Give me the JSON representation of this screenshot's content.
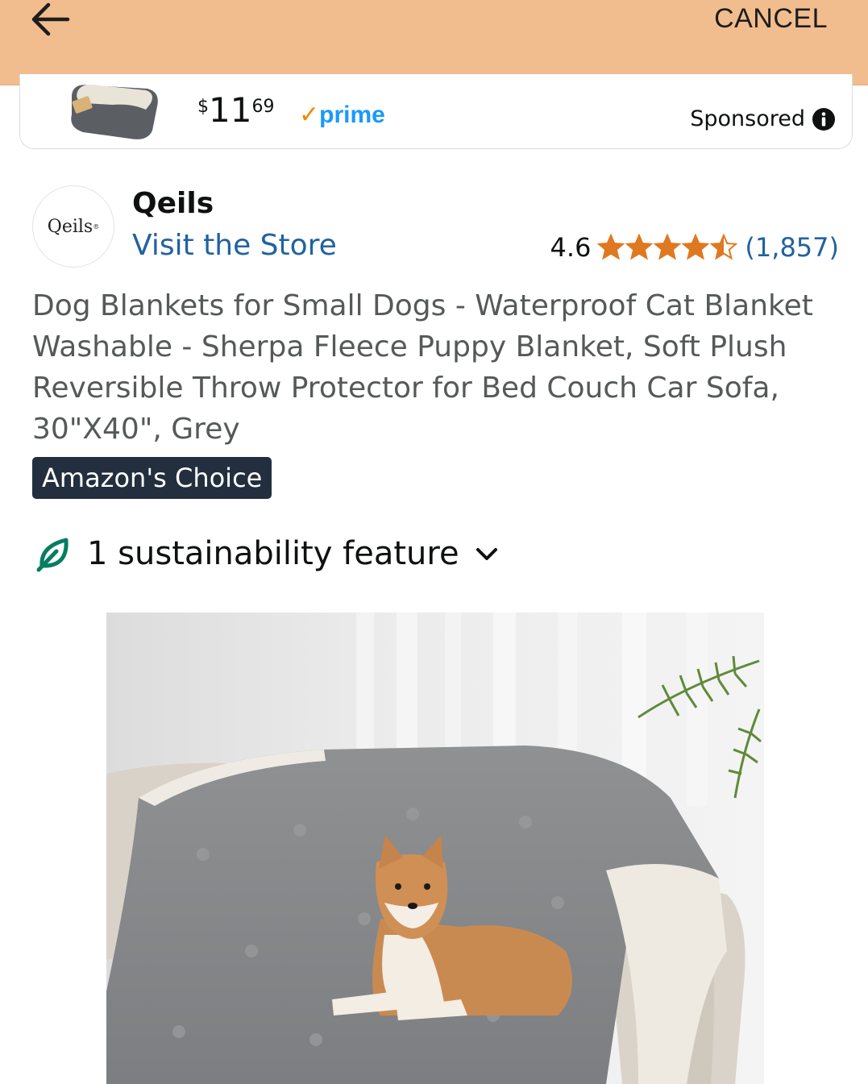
{
  "header": {
    "back_icon": "back-arrow-icon",
    "cancel_label": "CANCEL",
    "background_color": "#f2bd8e"
  },
  "sponsored_ad": {
    "price_symbol": "$",
    "price_whole": "11",
    "price_fraction": "69",
    "prime_label": "prime",
    "sponsored_label": "Sponsored",
    "info_icon": "info-icon"
  },
  "store": {
    "logo_text": "Qeils",
    "logo_mark": "®",
    "brand_name": "Qeils",
    "visit_label": "Visit the Store"
  },
  "rating": {
    "value": "4.6",
    "stars": 4.5,
    "count": "(1,857)",
    "star_color": "#de7921"
  },
  "product": {
    "title": "Dog Blankets for Small Dogs - Waterproof Cat Blanket Washable - Sherpa Fleece Puppy Blanket, Soft Plush Reversible Throw Protector for Bed Couch Car Sofa, 30\"X40\", Grey",
    "badge": "Amazon's Choice",
    "sustainability_label": "1 sustainability feature",
    "sustainability_icon": "leaf-icon",
    "expand_icon": "chevron-down-icon"
  },
  "colors": {
    "link": "#2162a1",
    "badge_bg": "#232f3e",
    "leaf": "#067d62"
  }
}
